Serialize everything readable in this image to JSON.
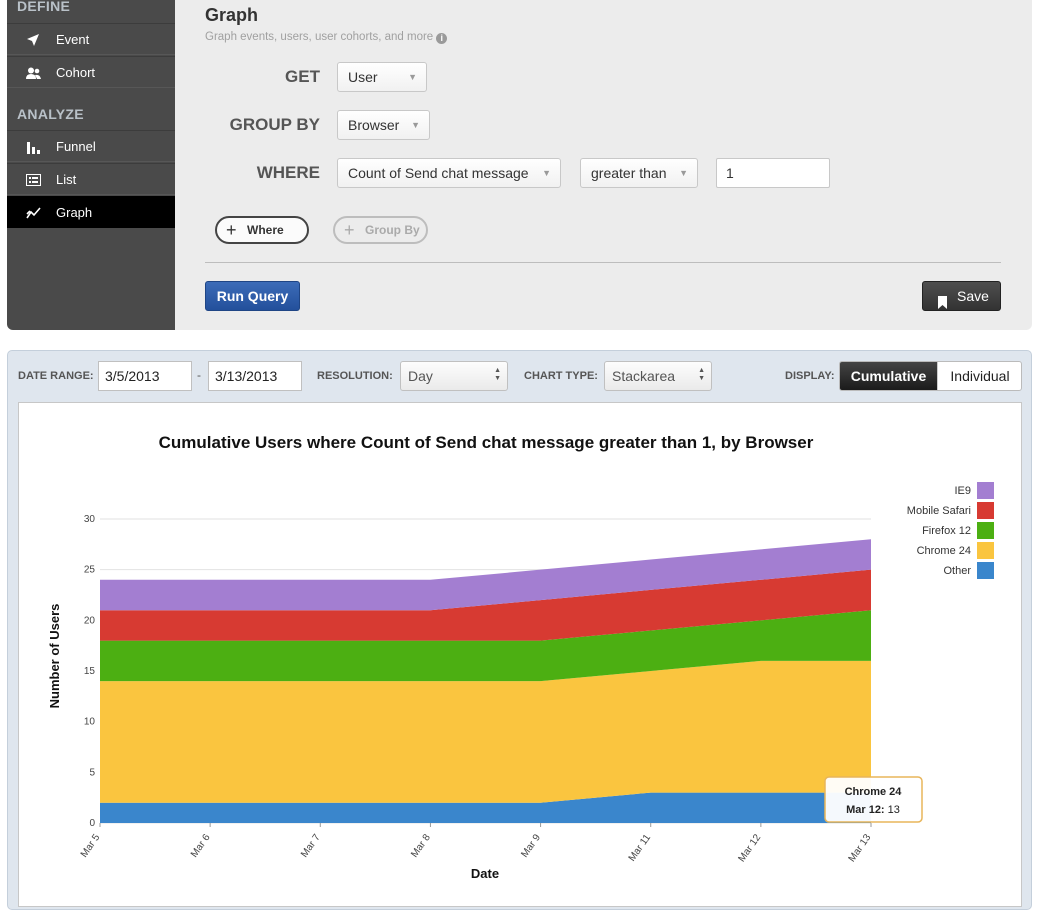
{
  "sidebar": {
    "define_heading": "DEFINE",
    "analyze_heading": "ANALYZE",
    "items": [
      {
        "label": "Event",
        "icon": "arrow-icon"
      },
      {
        "label": "Cohort",
        "icon": "users-icon"
      },
      {
        "label": "Funnel",
        "icon": "funnel-bars-icon"
      },
      {
        "label": "List",
        "icon": "list-icon"
      },
      {
        "label": "Graph",
        "icon": "graph-icon",
        "active": true
      }
    ]
  },
  "query": {
    "title": "Graph",
    "subtitle": "Graph events, users, user cohorts, and more",
    "get_label": "GET",
    "get_value": "User",
    "group_by_label": "GROUP BY",
    "group_by_value": "Browser",
    "where_label": "WHERE",
    "where_property": "Count of Send chat message",
    "where_operator": "greater than",
    "where_value": "1",
    "add_where": "Where",
    "add_group_by": "Group By",
    "run_button": "Run Query",
    "save_button": "Save"
  },
  "controls": {
    "date_range_label": "DATE RANGE:",
    "date_from": "3/5/2013",
    "date_sep": "-",
    "date_to": "3/13/2013",
    "resolution_label": "RESOLUTION:",
    "resolution_value": "Day",
    "chart_type_label": "CHART TYPE:",
    "chart_type_value": "Stackarea",
    "display_label": "DISPLAY:",
    "display_cumulative": "Cumulative",
    "display_individual": "Individual"
  },
  "colors": {
    "accent_blue": "#2b5aa6",
    "IE9": "#a37ed1",
    "Mobile Safari": "#d73a32",
    "Firefox 12": "#4caf12",
    "Chrome 24": "#fac53f",
    "Other": "#3a86cc"
  },
  "chart_data": {
    "type": "area",
    "stacked": true,
    "title": "Cumulative Users where Count of Send chat message greater than 1, by Browser",
    "xlabel": "Date",
    "ylabel": "Number of Users",
    "x": [
      "Mar 5",
      "Mar 6",
      "Mar 7",
      "Mar 8",
      "Mar 9",
      "Mar 11",
      "Mar 12",
      "Mar 13"
    ],
    "ylim": [
      0,
      30
    ],
    "yticks": [
      0,
      5,
      10,
      15,
      20,
      25,
      30
    ],
    "grid": true,
    "legend_position": "top-right",
    "series": [
      {
        "name": "Other",
        "values": [
          2,
          2,
          2,
          2,
          2,
          3,
          3,
          3
        ]
      },
      {
        "name": "Chrome 24",
        "values": [
          12,
          12,
          12,
          12,
          12,
          12,
          13,
          13
        ]
      },
      {
        "name": "Firefox 12",
        "values": [
          4,
          4,
          4,
          4,
          4,
          4,
          4,
          5
        ]
      },
      {
        "name": "Mobile Safari",
        "values": [
          3,
          3,
          3,
          3,
          4,
          4,
          4,
          4
        ]
      },
      {
        "name": "IE9",
        "values": [
          3,
          3,
          3,
          3,
          3,
          3,
          3,
          3
        ]
      }
    ],
    "legend_order": [
      "IE9",
      "Mobile Safari",
      "Firefox 12",
      "Chrome 24",
      "Other"
    ],
    "tooltip": {
      "series": "Chrome 24",
      "date": "Mar 12",
      "value": "13"
    }
  }
}
